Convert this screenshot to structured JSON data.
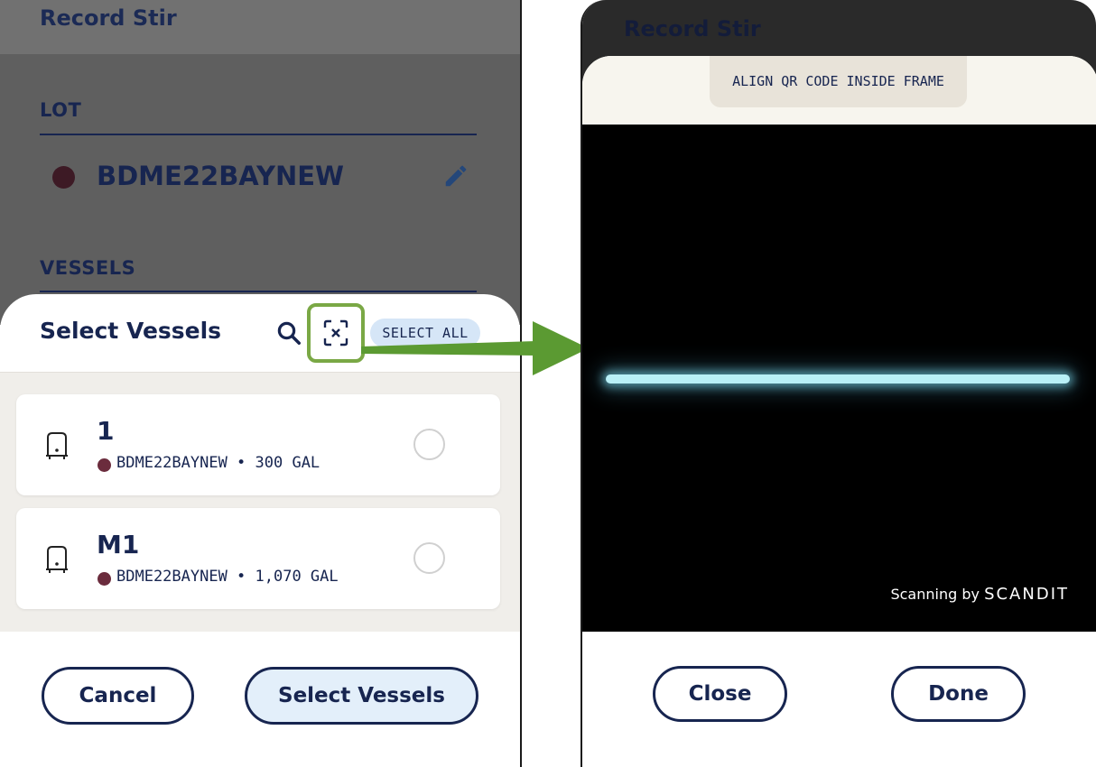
{
  "left_screen": {
    "header_title": "Record Stir",
    "lot_label": "LOT",
    "lot_name": "BDME22BAYNEW",
    "vessels_label": "VESSELS",
    "sheet": {
      "title": "Select Vessels",
      "select_all_label": "SELECT ALL",
      "vessels": [
        {
          "name": "1",
          "meta": "BDME22BAYNEW • 300 GAL"
        },
        {
          "name": "M1",
          "meta": "BDME22BAYNEW • 1,070 GAL"
        }
      ],
      "cancel_label": "Cancel",
      "confirm_label": "Select Vessels"
    }
  },
  "right_screen": {
    "header_title": "Record Stir",
    "banner_text": "ALIGN QR CODE INSIDE FRAME",
    "scanning_by": "Scanning by",
    "scanning_brand": "SCANDIT",
    "close_label": "Close",
    "done_label": "Done"
  },
  "colors": {
    "navy": "#172550",
    "highlight": "#7aa845",
    "arrow": "#5b9a32",
    "lot_dot": "#6b2c3d",
    "scan_line": "#b9f0f7"
  }
}
